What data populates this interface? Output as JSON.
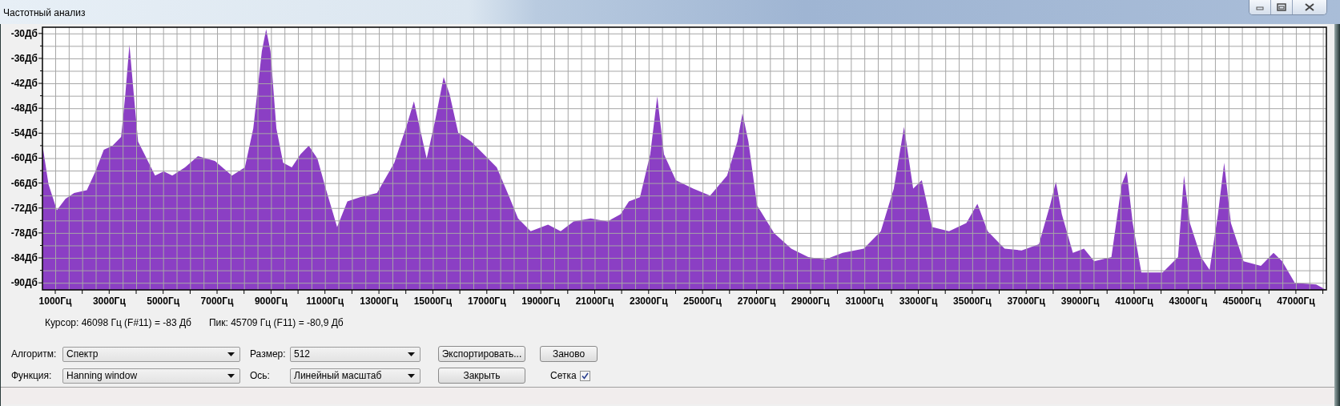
{
  "window": {
    "title": "Частотный анализ"
  },
  "chart": {
    "chart_data": {
      "type": "area",
      "grid": true,
      "xlim": [
        525,
        48130
      ],
      "ylim": [
        -91.7,
        -28.5
      ],
      "x": [
        525,
        530,
        750,
        1060,
        1380,
        1700,
        2170,
        2490,
        2800,
        3120,
        3440,
        3600,
        3750,
        3910,
        4070,
        4390,
        4700,
        5020,
        5340,
        5810,
        6290,
        6920,
        7550,
        8030,
        8340,
        8660,
        8820,
        8980,
        9200,
        9450,
        9770,
        10090,
        10400,
        10720,
        11030,
        11450,
        11830,
        12300,
        12930,
        13570,
        14040,
        14300,
        14520,
        14770,
        15090,
        15400,
        15620,
        15940,
        16420,
        16890,
        17370,
        17840,
        18160,
        18630,
        19270,
        19740,
        20220,
        20850,
        21480,
        21960,
        22270,
        22680,
        23060,
        23320,
        23570,
        24010,
        24650,
        25280,
        25910,
        26290,
        26480,
        26700,
        27020,
        27650,
        28290,
        28920,
        29550,
        30190,
        30980,
        31610,
        32090,
        32470,
        32810,
        33130,
        33510,
        34140,
        34780,
        35190,
        35570,
        36200,
        36830,
        37470,
        37880,
        38100,
        38320,
        38730,
        39140,
        39520,
        40160,
        40540,
        40730,
        40950,
        41270,
        42060,
        42630,
        42850,
        43070,
        43480,
        43800,
        44110,
        44340,
        44590,
        45060,
        45700,
        46170,
        46490,
        46960,
        47750,
        48100
      ],
      "series": [
        {
          "color": "#8b3fc4",
          "values": [
            -91.7,
            -57,
            -66.3,
            -72.5,
            -69.8,
            -68.4,
            -67.7,
            -63.2,
            -58,
            -57,
            -54.9,
            -44.6,
            -32.7,
            -44.6,
            -56,
            -60.1,
            -64.2,
            -63.2,
            -64.2,
            -62.2,
            -59.5,
            -60.7,
            -64.2,
            -62.2,
            -52.9,
            -34.3,
            -29,
            -34.3,
            -52.9,
            -61.1,
            -62.2,
            -59.1,
            -57,
            -60.1,
            -67.3,
            -76.6,
            -70.4,
            -69.4,
            -68.4,
            -61.1,
            -51.9,
            -46.3,
            -52.9,
            -60.1,
            -50.8,
            -40.5,
            -44.6,
            -53.9,
            -56,
            -59.1,
            -62.2,
            -69.4,
            -74.5,
            -77.6,
            -76,
            -77.6,
            -75.2,
            -74.5,
            -75.2,
            -73.5,
            -70.4,
            -69.4,
            -59.1,
            -45.1,
            -59.1,
            -65.3,
            -67.3,
            -69,
            -64.2,
            -56,
            -49.2,
            -56,
            -71.4,
            -78,
            -81.8,
            -83.8,
            -84.4,
            -82.8,
            -81.8,
            -77.6,
            -67.3,
            -52.5,
            -67.3,
            -65.3,
            -76.6,
            -77.6,
            -75.6,
            -71,
            -77.6,
            -81.8,
            -82.2,
            -80.7,
            -71.4,
            -65.7,
            -73.5,
            -82.8,
            -81.8,
            -84.8,
            -83.8,
            -66.3,
            -63.2,
            -75.6,
            -87.5,
            -87.5,
            -83.8,
            -64.2,
            -75.6,
            -83.8,
            -86.9,
            -73.5,
            -61.1,
            -75.6,
            -84.8,
            -85.9,
            -82.8,
            -84.8,
            -90,
            -90.4,
            -91.6
          ]
        }
      ],
      "xticks": [
        {
          "value": 1000,
          "label": "1000Гц"
        },
        {
          "value": 3000,
          "label": "3000Гц"
        },
        {
          "value": 5000,
          "label": "5000Гц"
        },
        {
          "value": 7000,
          "label": "7000Гц"
        },
        {
          "value": 9000,
          "label": "9000Гц"
        },
        {
          "value": 11000,
          "label": "11000Гц"
        },
        {
          "value": 13000,
          "label": "13000Гц"
        },
        {
          "value": 15000,
          "label": "15000Гц"
        },
        {
          "value": 17000,
          "label": "17000Гц"
        },
        {
          "value": 19000,
          "label": "19000Гц"
        },
        {
          "value": 21000,
          "label": "21000Гц"
        },
        {
          "value": 23000,
          "label": "23000Гц"
        },
        {
          "value": 25000,
          "label": "25000Гц"
        },
        {
          "value": 27000,
          "label": "27000Гц"
        },
        {
          "value": 29000,
          "label": "29000Гц"
        },
        {
          "value": 31000,
          "label": "31000Гц"
        },
        {
          "value": 33000,
          "label": "33000Гц"
        },
        {
          "value": 35000,
          "label": "35000Гц"
        },
        {
          "value": 37000,
          "label": "37000Гц"
        },
        {
          "value": 39000,
          "label": "39000Гц"
        },
        {
          "value": 41000,
          "label": "41000Гц"
        },
        {
          "value": 43000,
          "label": "43000Гц"
        },
        {
          "value": 45000,
          "label": "45000Гц"
        },
        {
          "value": 47000,
          "label": "47000Гц"
        }
      ],
      "yticks": [
        {
          "value": -30,
          "label": "-30Дб"
        },
        {
          "value": -36,
          "label": "-36Дб"
        },
        {
          "value": -42,
          "label": "-42Дб"
        },
        {
          "value": -48,
          "label": "-48Дб"
        },
        {
          "value": -54,
          "label": "-54Дб"
        },
        {
          "value": -60,
          "label": "-60Дб"
        },
        {
          "value": -66,
          "label": "-66Дб"
        },
        {
          "value": -72,
          "label": "-72Дб"
        },
        {
          "value": -78,
          "label": "-78Дб"
        },
        {
          "value": -84,
          "label": "-84Дб"
        },
        {
          "value": -90,
          "label": "-90Дб"
        }
      ]
    }
  },
  "readout": {
    "cursor": "Курсор: 46098 Гц (F#11) = -83 Дб",
    "peak": "Пик: 45709 Гц (F11) = -80,9 Дб"
  },
  "controls": {
    "algorithm": {
      "label": "Алгоритм:",
      "value": "Спектр"
    },
    "size": {
      "label": "Размер:",
      "value": "512"
    },
    "function": {
      "label": "Функция:",
      "value": "Hanning window"
    },
    "axis": {
      "label": "Ось:",
      "value": "Линейный масштаб"
    },
    "buttons": [
      "Экспортировать...",
      "Заново",
      "Закрыть"
    ],
    "grid": {
      "label": "Сетка",
      "checked": true
    }
  }
}
